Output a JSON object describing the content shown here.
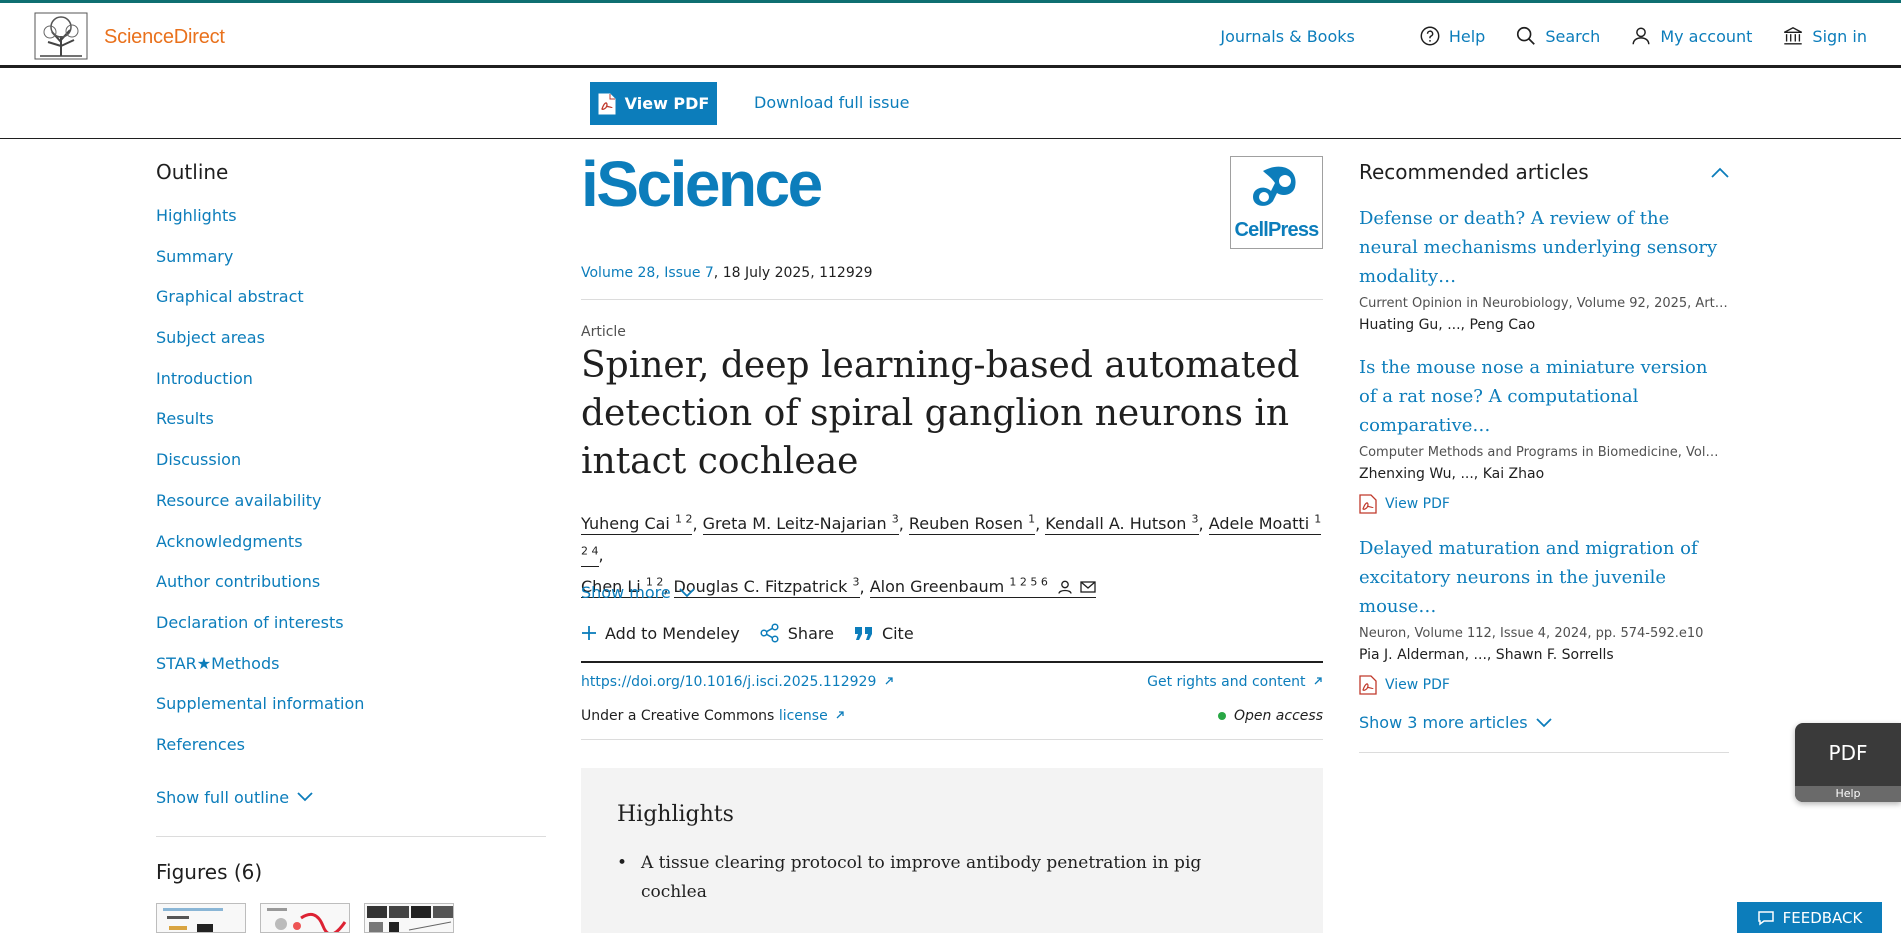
{
  "header": {
    "logo_text": "ScienceDirect",
    "nav": [
      {
        "label": "Journals & Books",
        "icon": "none"
      },
      {
        "label": "Help",
        "icon": "help-circle-icon"
      },
      {
        "label": "Search",
        "icon": "search-icon"
      },
      {
        "label": "My account",
        "icon": "person-icon"
      },
      {
        "label": "Sign in",
        "icon": "institution-icon"
      }
    ]
  },
  "toolbar": {
    "view_pdf": "View PDF",
    "download_issue": "Download full issue"
  },
  "outline": {
    "title": "Outline",
    "items": [
      "Highlights",
      "Summary",
      "Graphical abstract",
      "Subject areas",
      "Introduction",
      "Results",
      "Discussion",
      "Resource availability",
      "Acknowledgments",
      "Author contributions",
      "Declaration of interests",
      "STAR★Methods",
      "Supplemental information",
      "References"
    ],
    "show_full": "Show full outline",
    "figures_title": "Figures (6)"
  },
  "article": {
    "journal": "iScience",
    "publisher_logo": "CellPress",
    "volume_link": "Volume 28, Issue 7",
    "volume_rest": ", 18 July 2025, 112929",
    "type": "Article",
    "title": "Spiner, deep learning-based automated detection of spiral ganglion neurons in intact cochleae",
    "authors": [
      {
        "name": "Yuheng Cai",
        "sup": "1 2"
      },
      {
        "name": "Greta M. Leitz-Najarian",
        "sup": "3"
      },
      {
        "name": "Reuben Rosen",
        "sup": "1"
      },
      {
        "name": "Kendall A. Hutson",
        "sup": "3"
      },
      {
        "name": "Adele Moatti",
        "sup": "1 2 4"
      },
      {
        "name": "Chen Li",
        "sup": "1 2"
      },
      {
        "name": "Douglas C. Fitzpatrick",
        "sup": "3"
      },
      {
        "name": "Alon Greenbaum",
        "sup": "1 2 5 6"
      }
    ],
    "show_more": "Show more",
    "actions": {
      "mendeley": "Add to Mendeley",
      "share": "Share",
      "cite": "Cite"
    },
    "doi": "https://doi.org/10.1016/j.isci.2025.112929",
    "rights": "Get rights and content",
    "license_prefix": "Under a Creative Commons ",
    "license_link": "license",
    "open_access": "Open access",
    "highlights_title": "Highlights",
    "highlights": [
      "A tissue clearing protocol to improve antibody penetration in pig cochlea"
    ]
  },
  "recommended": {
    "title": "Recommended articles",
    "items": [
      {
        "title": "Defense or death? A review of the neural mechanisms underlying sensory modality…",
        "source": "Current Opinion in Neurobiology, Volume 92, 2025, Art…",
        "authors": "Huating Gu, ..., Peng Cao",
        "pdf": ""
      },
      {
        "title": "Is the mouse nose a miniature version of a rat nose? A computational comparative…",
        "source": "Computer Methods and Programs in Biomedicine, Vol…",
        "authors": "Zhenxing Wu, ..., Kai Zhao",
        "pdf": "View PDF"
      },
      {
        "title": "Delayed maturation and migration of excitatory neurons in the juvenile mouse…",
        "source": "Neuron, Volume 112, Issue 4, 2024, pp. 574-592.e10",
        "authors": "Pia J. Alderman, ..., Shawn F. Sorrells",
        "pdf": "View PDF"
      }
    ],
    "show_more": "Show 3 more articles"
  },
  "widgets": {
    "pdf": "PDF",
    "help": "Help",
    "feedback": "FEEDBACK"
  },
  "colors": {
    "link": "#0c7dbb",
    "brand_orange": "#e9711c",
    "top_border": "#0e6f71",
    "open_access": "#28a745"
  }
}
